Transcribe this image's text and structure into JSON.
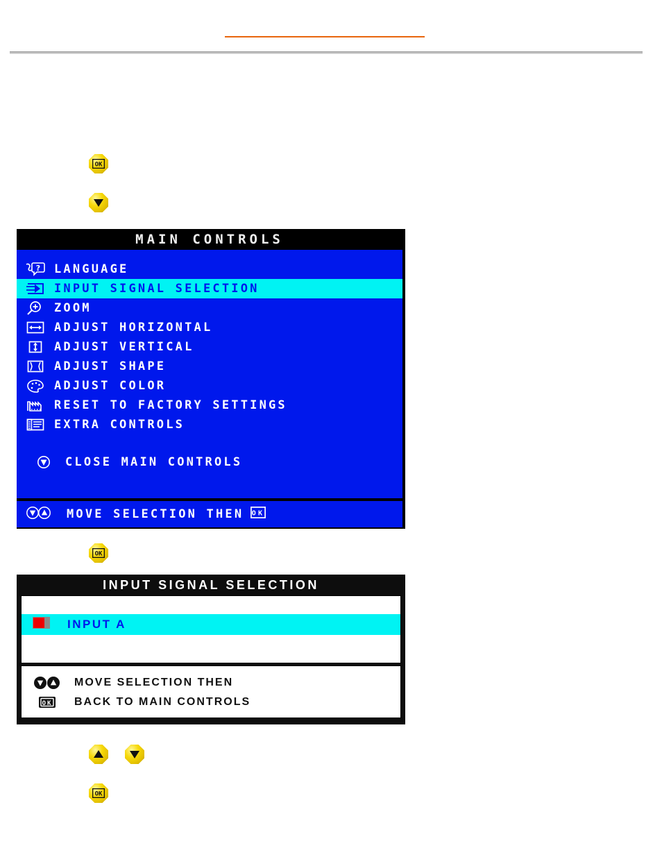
{
  "page": {
    "accent_orange": "#e8650d",
    "osd_blue": "#0018ec",
    "osd_cyan": "#00f3f3",
    "osd_black": "#000000",
    "button_yellow": "#f7d90a"
  },
  "buttons": {
    "ok_top": {
      "icon": "ok-button-icon",
      "label": "OK"
    },
    "down_top": {
      "icon": "down-arrow-button-icon",
      "label": "Down"
    },
    "ok_middle": {
      "icon": "ok-button-icon",
      "label": "OK"
    },
    "up_bottom": {
      "icon": "up-arrow-button-icon",
      "label": "Up"
    },
    "down_bottom": {
      "icon": "down-arrow-button-icon",
      "label": "Down"
    },
    "ok_bottom": {
      "icon": "ok-button-icon",
      "label": "OK"
    }
  },
  "main_controls": {
    "title": "MAIN CONTROLS",
    "items": [
      {
        "icon": "language-speech-icon",
        "label": "LANGUAGE",
        "selected": false
      },
      {
        "icon": "input-signal-icon",
        "label": "INPUT SIGNAL SELECTION",
        "selected": true
      },
      {
        "icon": "magnifier-plus-icon",
        "label": "ZOOM",
        "selected": false
      },
      {
        "icon": "adjust-horizontal-icon",
        "label": "ADJUST HORIZONTAL",
        "selected": false
      },
      {
        "icon": "adjust-vertical-icon",
        "label": "ADJUST VERTICAL",
        "selected": false
      },
      {
        "icon": "adjust-shape-icon",
        "label": "ADJUST SHAPE",
        "selected": false
      },
      {
        "icon": "color-palette-icon",
        "label": "ADJUST COLOR",
        "selected": false
      },
      {
        "icon": "factory-reset-icon",
        "label": "RESET TO FACTORY SETTINGS",
        "selected": false
      },
      {
        "icon": "extra-controls-icon",
        "label": "EXTRA CONTROLS",
        "selected": false
      }
    ],
    "close_item": {
      "icon": "down-arrow-circle-icon",
      "label": "CLOSE MAIN CONTROLS"
    },
    "footer": {
      "icons": "down-up-arrow-circle-icons",
      "label": "MOVE SELECTION THEN",
      "end_icon": "ok-box-icon"
    }
  },
  "input_signal_selection": {
    "title": "INPUT SIGNAL SELECTION",
    "items": [
      {
        "icon": "input-a-connector-icon",
        "label": "INPUT A",
        "selected": true
      }
    ],
    "hints": [
      {
        "icons": "down-up-arrow-circle-icons",
        "label": "MOVE SELECTION THEN"
      },
      {
        "icons": "ok-box-icon",
        "label": "BACK TO MAIN CONTROLS"
      }
    ]
  }
}
